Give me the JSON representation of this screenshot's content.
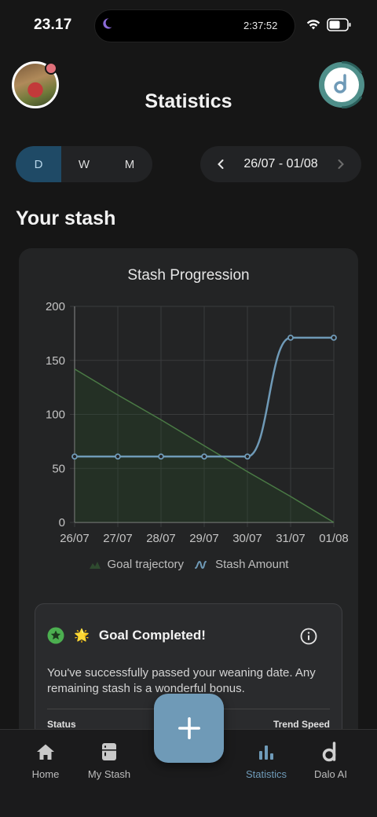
{
  "status_bar": {
    "time": "23.17",
    "island_time": "2:37:52"
  },
  "header": {
    "title": "Statistics"
  },
  "period_switch": {
    "options": [
      "D",
      "W",
      "M"
    ],
    "selected": "D"
  },
  "date_range": {
    "label": "26/07 - 01/08"
  },
  "section": {
    "title": "Your stash"
  },
  "chart_data": {
    "type": "line",
    "title": "Stash Progression",
    "x": [
      "26/07",
      "27/07",
      "28/07",
      "29/07",
      "30/07",
      "31/07",
      "01/08"
    ],
    "ylim": [
      0,
      200
    ],
    "yticks": [
      0,
      50,
      100,
      150,
      200
    ],
    "grid": true,
    "legend_position": "bottom",
    "series": [
      {
        "name": "Goal trajectory",
        "values": [
          142,
          118,
          95,
          71,
          47,
          24,
          0
        ],
        "color": "#4a7a45",
        "style": "area"
      },
      {
        "name": "Stash Amount",
        "values": [
          61,
          61,
          61,
          61,
          61,
          171,
          171
        ],
        "color": "#6f9ab7",
        "style": "line"
      }
    ]
  },
  "goal_card": {
    "emoji": "🌟",
    "title": "Goal Completed!",
    "message": "You've successfully passed your weaning date. Any remaining stash is a wonderful bonus.",
    "col_left": "Status",
    "col_right": "Trend Speed"
  },
  "bottom_nav": {
    "items": [
      {
        "label": "Home",
        "icon": "home-icon"
      },
      {
        "label": "My Stash",
        "icon": "fridge-icon"
      },
      {
        "label": "Statistics",
        "icon": "bar-chart-icon"
      },
      {
        "label": "Dalo AI",
        "icon": "dalo-logo-icon"
      }
    ],
    "active": "Statistics"
  },
  "colors": {
    "accent": "#6f9ab7",
    "goal": "#4a7a45",
    "background": "#161616",
    "card": "#232425"
  }
}
